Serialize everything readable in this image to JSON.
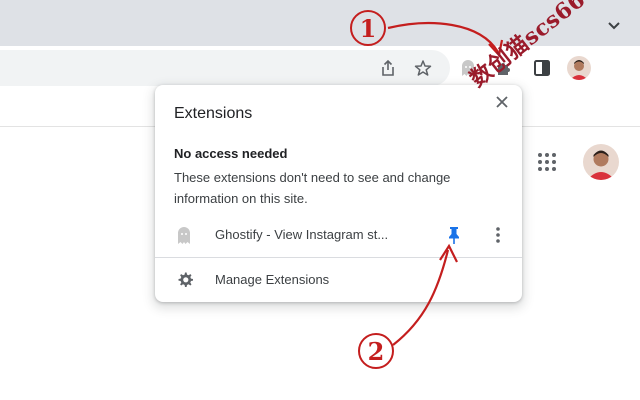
{
  "browser": {
    "toolbar_icons": [
      "share-icon",
      "bookmark-star-icon",
      "ghostify-icon",
      "extensions-puzzle-icon",
      "side-panel-icon"
    ],
    "tab_overflow_icon": "chevron-down-icon"
  },
  "page": {
    "apps_icon": "apps-grid-icon"
  },
  "popup": {
    "title": "Extensions",
    "section_heading": "No access needed",
    "section_description": "These extensions don't need to see and change information on this site.",
    "extension": {
      "name": "Ghostify - View Instagram st...",
      "icon": "ghost-icon",
      "pinned": true,
      "pin_color": "#1a73e8"
    },
    "manage_label": "Manage Extensions",
    "manage_icon": "gear-icon"
  },
  "annotations": {
    "label_1": "1",
    "label_2": "2",
    "watermark": "数创猫scs66",
    "annotation_color": "#c41e1e"
  }
}
